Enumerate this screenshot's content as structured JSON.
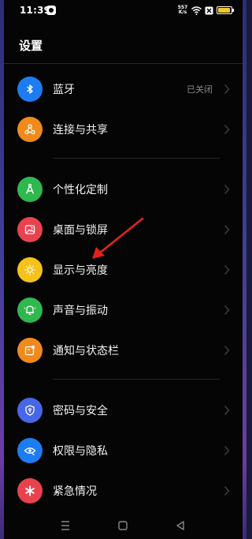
{
  "status_bar": {
    "time": "11:39",
    "net_speed": "557 K/s",
    "battery_level": 0.95
  },
  "page": {
    "title": "设置"
  },
  "settings": [
    {
      "id": "bluetooth",
      "label": "蓝牙",
      "value": "已关闭",
      "icon": "bluetooth-icon",
      "color": "#1e7cf2"
    },
    {
      "id": "connection",
      "label": "连接与共享",
      "value": "",
      "icon": "share-icon",
      "color": "#f08a1c"
    },
    {
      "id": "personalization",
      "label": "个性化定制",
      "value": "",
      "icon": "compass-icon",
      "color": "#2fb84d"
    },
    {
      "id": "wallpaper",
      "label": "桌面与锁屏",
      "value": "",
      "icon": "image-icon",
      "color": "#e8434d"
    },
    {
      "id": "display",
      "label": "显示与亮度",
      "value": "",
      "icon": "sun-icon",
      "color": "#f4c21a"
    },
    {
      "id": "sound",
      "label": "声音与振动",
      "value": "",
      "icon": "bell-icon",
      "color": "#2fb84d"
    },
    {
      "id": "notification",
      "label": "通知与状态栏",
      "value": "",
      "icon": "notification-icon",
      "color": "#f08a1c"
    },
    {
      "id": "security",
      "label": "密码与安全",
      "value": "",
      "icon": "shield-icon",
      "color": "#4767e6"
    },
    {
      "id": "privacy",
      "label": "权限与隐私",
      "value": "",
      "icon": "eye-icon",
      "color": "#1e7cf2"
    },
    {
      "id": "emergency",
      "label": "紧急情况",
      "value": "",
      "icon": "asterisk-icon",
      "color": "#e8434d"
    }
  ],
  "annotation": {
    "color": "#e0241c"
  }
}
